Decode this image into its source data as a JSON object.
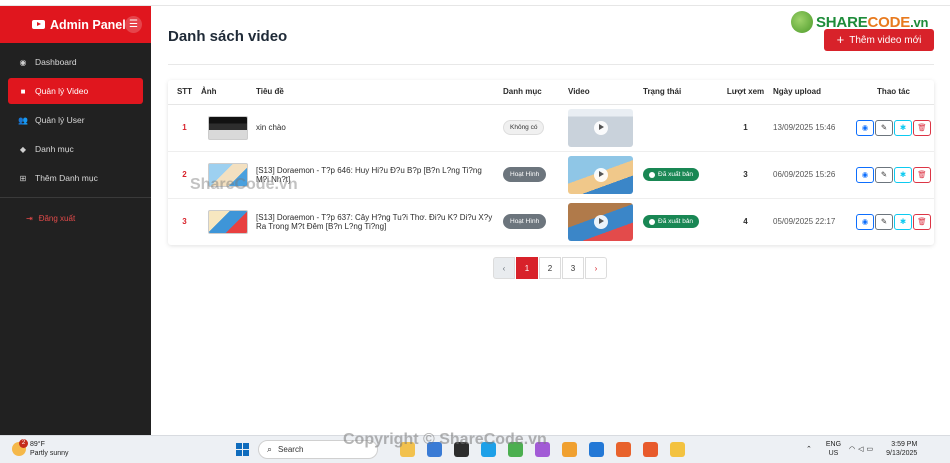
{
  "sidebar": {
    "brand": "Admin Panel",
    "items": [
      {
        "label": "Dashboard",
        "icon": "dashboard-icon",
        "active": false
      },
      {
        "label": "Quản lý Video",
        "icon": "video-icon",
        "active": true
      },
      {
        "label": "Quản lý User",
        "icon": "users-icon",
        "active": false
      },
      {
        "label": "Danh mục",
        "icon": "tags-icon",
        "active": false
      },
      {
        "label": "Thêm Danh mục",
        "icon": "plus-square-icon",
        "active": false
      }
    ],
    "logout": "Đăng xuất"
  },
  "main": {
    "title": "Danh sách video",
    "add_button": "Thêm video mới",
    "logo": {
      "share": "SHARE",
      "code": "CODE",
      "vn": ".vn"
    },
    "columns": [
      "STT",
      "Ảnh",
      "Tiêu đề",
      "Danh mục",
      "Video",
      "Trạng thái",
      "Lượt xem",
      "Ngày upload",
      "Thao tác"
    ],
    "rows": [
      {
        "stt": "1",
        "title": "xin chào",
        "category": "Không có",
        "status": "",
        "views": "1",
        "date": "13/09/2025 15:46"
      },
      {
        "stt": "2",
        "title": "[S13] Doraemon - T?p 646: Huy Hi?u Đ?u B?p [B?n L?ng Ti?ng M?i Nh?t]",
        "category": "Hoạt Hình",
        "status": "Đã xuất bản",
        "views": "3",
        "date": "06/09/2025 15:26"
      },
      {
        "stt": "3",
        "title": "[S13] Doraemon - T?p 637: Cây H?ng Tu?i Thơ. Đi?u K? Di?u X?y Ra Trong M?t Đêm [B?n L?ng Ti?ng]",
        "category": "Hoạt Hình",
        "status": "Đã xuất bản",
        "views": "4",
        "date": "05/09/2025 22:17"
      }
    ],
    "pagination": {
      "pages": [
        "1",
        "2",
        "3"
      ],
      "current": "1"
    }
  },
  "watermarks": {
    "center": "ShareCode.vn",
    "bottom": "Copyright © ShareCode.vn"
  },
  "taskbar": {
    "weather_temp": "89°F",
    "weather_desc": "Partly sunny",
    "notification_count": "2",
    "search_placeholder": "Search",
    "lang_line1": "ENG",
    "lang_line2": "US",
    "time": "3:59 PM",
    "date": "9/13/2025"
  },
  "colors": {
    "accent": "#d8222a",
    "sidebar_bg": "#212121",
    "success": "#198754"
  }
}
